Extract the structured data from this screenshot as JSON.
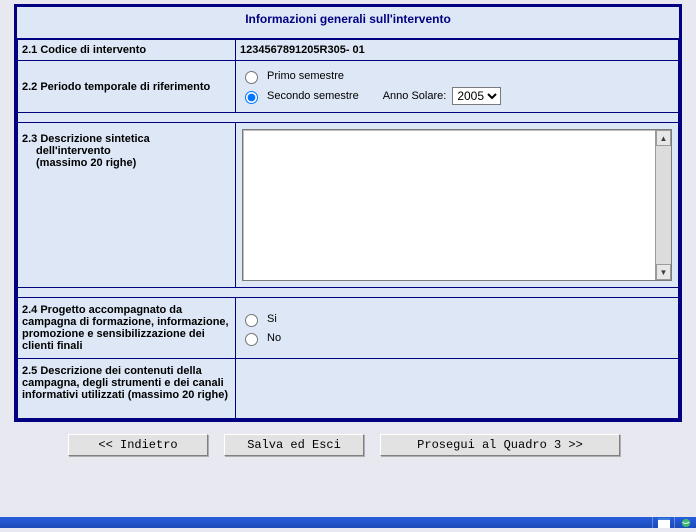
{
  "title": "Informazioni generali sull'intervento",
  "rows": {
    "r1": {
      "label": "2.1 Codice di intervento",
      "value": "1234567891205R305- 01"
    },
    "r2": {
      "label": "2.2 Periodo temporale di riferimento",
      "option_primo": "Primo semestre",
      "option_secondo": "Secondo semestre",
      "anno_label": "Anno Solare:",
      "anno_value": "2005"
    },
    "r3": {
      "label_line1": "2.3 Descrizione sintetica",
      "label_line2": "dell'intervento",
      "label_line3": "(massimo 20 righe)",
      "value": ""
    },
    "r4": {
      "label": "2.4 Progetto accompagnato da campagna di formazione, informazione, promozione e sensibilizzazione dei clienti finali",
      "option_si": "Si",
      "option_no": "No"
    },
    "r5": {
      "label": "2.5 Descrizione dei contenuti della campagna, degli strumenti e dei canali informativi utilizzati (massimo 20 righe)"
    }
  },
  "buttons": {
    "back": "<< Indietro",
    "save": "Salva ed Esci",
    "next": "Prosegui al Quadro 3 >>"
  }
}
